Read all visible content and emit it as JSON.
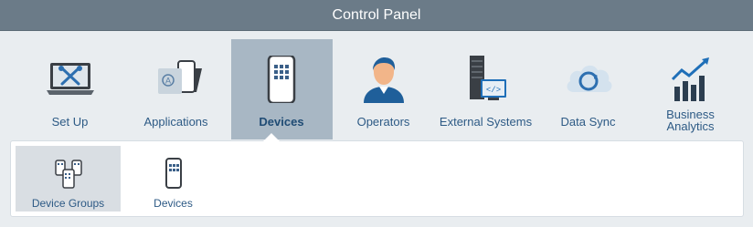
{
  "window": {
    "title": "Control Panel"
  },
  "main_nav": [
    {
      "label": "Set Up",
      "icon": "laptop-tools-icon"
    },
    {
      "label": "Applications",
      "icon": "applications-icon"
    },
    {
      "label": "Devices",
      "icon": "smartphone-icon",
      "active": true
    },
    {
      "label": "Operators",
      "icon": "operator-icon"
    },
    {
      "label": "External Systems",
      "icon": "server-code-icon"
    },
    {
      "label": "Data Sync",
      "icon": "cloud-sync-icon"
    },
    {
      "label": "Business Analytics",
      "icon": "analytics-chart-icon"
    }
  ],
  "sub_nav": [
    {
      "label": "Device Groups",
      "icon": "device-groups-icon",
      "active": true
    },
    {
      "label": "Devices",
      "icon": "device-icon"
    }
  ],
  "colors": {
    "title_bar": "#6b7b88",
    "active_tab": "#a8b7c4",
    "label_text": "#2d5a85",
    "sub_active": "#d9dee3",
    "background": "#e9edf0"
  }
}
